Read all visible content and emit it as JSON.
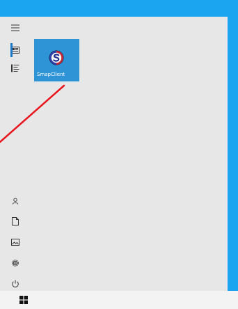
{
  "start_menu": {
    "tiles": [
      {
        "label": "SmapClient",
        "icon": "smapclient-logo-icon"
      }
    ],
    "rail_icons": [
      "hamburger-menu-icon",
      "tiles-view-icon",
      "all-apps-list-icon",
      "user-account-icon",
      "documents-icon",
      "pictures-icon",
      "settings-icon",
      "power-icon"
    ]
  },
  "annotation": {
    "color": "#e8141c"
  },
  "colors": {
    "desktop_blue": "#1ba4f0",
    "menu_bg": "#e7e7e7",
    "tile_bg": "#2f94d6",
    "accent": "#1a78c9"
  }
}
